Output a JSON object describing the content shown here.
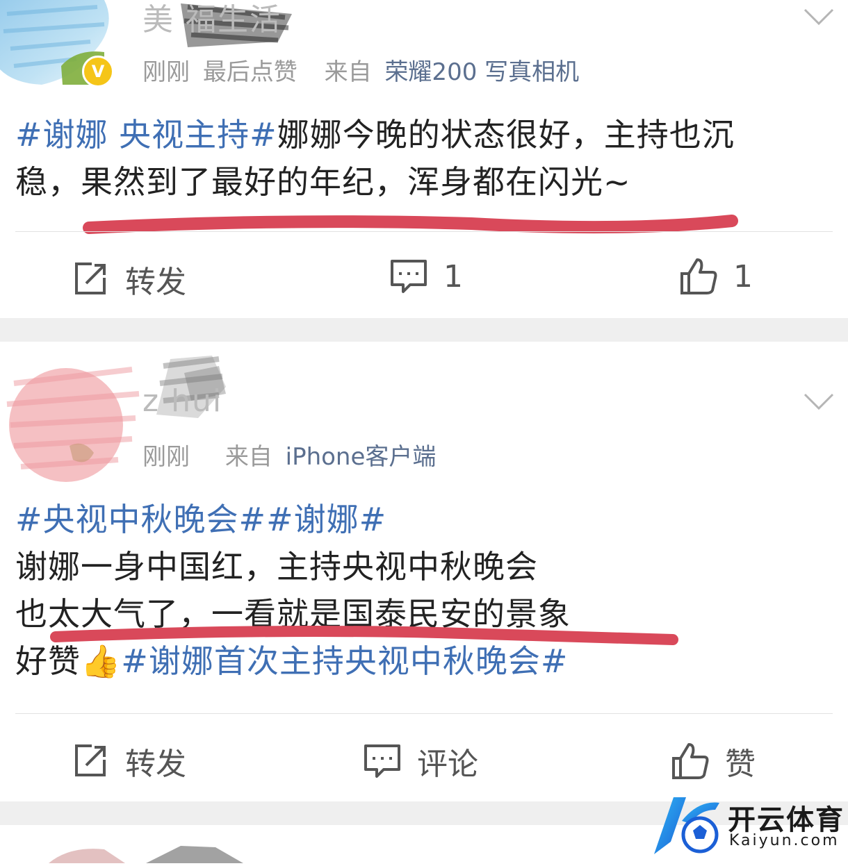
{
  "post1": {
    "username": "美 福生活",
    "verified_badge": "V",
    "time": "刚刚",
    "last_like": "最后点赞",
    "from_label": "来自",
    "source": "荣耀200 写真相机",
    "topic": "#谢娜 央视主持#",
    "text_line1": "娜娜今晚的状态很好，主持也沉",
    "text_line2": "稳，果然到了最好的年纪，浑身都在闪光~",
    "repost_label": "转发",
    "comment_count": "1",
    "like_count": "1"
  },
  "post2": {
    "username": "z    hui",
    "time": "刚刚",
    "from_label": "来自",
    "source": "iPhone客户端",
    "topic1": "#央视中秋晚会#",
    "topic2": "#谢娜#",
    "text_line1": "谢娜一身中国红，主持央视中秋晚会",
    "text_line2": "也太大气了，一看就是国泰民安的景象",
    "text_line3_prefix": "好赞",
    "emoji": "👍",
    "topic3": "#谢娜首次主持央视中秋晚会#",
    "repost_label": "转发",
    "comment_label": "评论",
    "like_label": "赞"
  },
  "watermark": {
    "cn": "开云体育",
    "en": "Kaiyun.com"
  },
  "colors": {
    "topic_blue": "#3f6fb4",
    "underline_red": "#d9495a",
    "separator": "#efefef"
  },
  "icons": [
    "repost-icon",
    "comment-icon",
    "like-icon",
    "chevron-down-icon",
    "verified-icon"
  ]
}
